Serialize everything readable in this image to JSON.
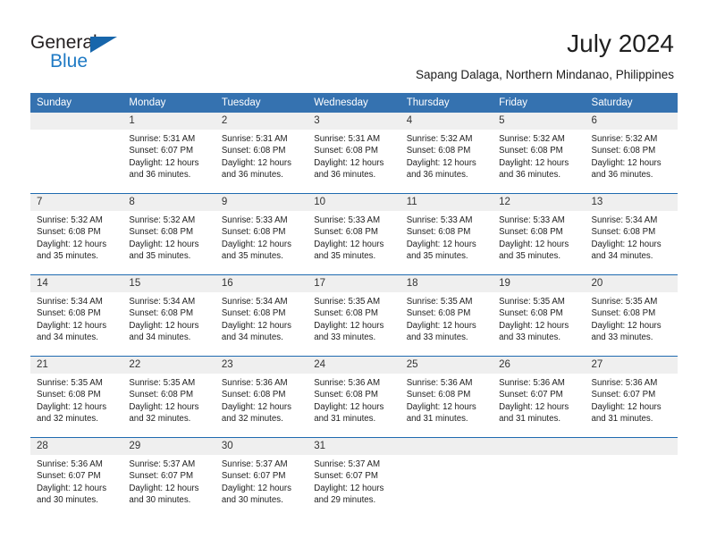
{
  "brand": {
    "word1": "General",
    "word2": "Blue",
    "triangle_color": "#1766ab",
    "blue_color": "#1f7ac4"
  },
  "header": {
    "month_title": "July 2024",
    "location": "Sapang Dalaga, Northern Mindanao, Philippines",
    "header_bg": "#3572b0",
    "daynum_bg": "#efefef",
    "week_separator_color": "#1f6bb0"
  },
  "calendar": {
    "weekday_headers": [
      "Sunday",
      "Monday",
      "Tuesday",
      "Wednesday",
      "Thursday",
      "Friday",
      "Saturday"
    ],
    "weeks": [
      [
        {
          "day": "",
          "lines": []
        },
        {
          "day": "1",
          "lines": [
            "Sunrise: 5:31 AM",
            "Sunset: 6:07 PM",
            "Daylight: 12 hours",
            "and 36 minutes."
          ]
        },
        {
          "day": "2",
          "lines": [
            "Sunrise: 5:31 AM",
            "Sunset: 6:08 PM",
            "Daylight: 12 hours",
            "and 36 minutes."
          ]
        },
        {
          "day": "3",
          "lines": [
            "Sunrise: 5:31 AM",
            "Sunset: 6:08 PM",
            "Daylight: 12 hours",
            "and 36 minutes."
          ]
        },
        {
          "day": "4",
          "lines": [
            "Sunrise: 5:32 AM",
            "Sunset: 6:08 PM",
            "Daylight: 12 hours",
            "and 36 minutes."
          ]
        },
        {
          "day": "5",
          "lines": [
            "Sunrise: 5:32 AM",
            "Sunset: 6:08 PM",
            "Daylight: 12 hours",
            "and 36 minutes."
          ]
        },
        {
          "day": "6",
          "lines": [
            "Sunrise: 5:32 AM",
            "Sunset: 6:08 PM",
            "Daylight: 12 hours",
            "and 36 minutes."
          ]
        }
      ],
      [
        {
          "day": "7",
          "lines": [
            "Sunrise: 5:32 AM",
            "Sunset: 6:08 PM",
            "Daylight: 12 hours",
            "and 35 minutes."
          ]
        },
        {
          "day": "8",
          "lines": [
            "Sunrise: 5:32 AM",
            "Sunset: 6:08 PM",
            "Daylight: 12 hours",
            "and 35 minutes."
          ]
        },
        {
          "day": "9",
          "lines": [
            "Sunrise: 5:33 AM",
            "Sunset: 6:08 PM",
            "Daylight: 12 hours",
            "and 35 minutes."
          ]
        },
        {
          "day": "10",
          "lines": [
            "Sunrise: 5:33 AM",
            "Sunset: 6:08 PM",
            "Daylight: 12 hours",
            "and 35 minutes."
          ]
        },
        {
          "day": "11",
          "lines": [
            "Sunrise: 5:33 AM",
            "Sunset: 6:08 PM",
            "Daylight: 12 hours",
            "and 35 minutes."
          ]
        },
        {
          "day": "12",
          "lines": [
            "Sunrise: 5:33 AM",
            "Sunset: 6:08 PM",
            "Daylight: 12 hours",
            "and 35 minutes."
          ]
        },
        {
          "day": "13",
          "lines": [
            "Sunrise: 5:34 AM",
            "Sunset: 6:08 PM",
            "Daylight: 12 hours",
            "and 34 minutes."
          ]
        }
      ],
      [
        {
          "day": "14",
          "lines": [
            "Sunrise: 5:34 AM",
            "Sunset: 6:08 PM",
            "Daylight: 12 hours",
            "and 34 minutes."
          ]
        },
        {
          "day": "15",
          "lines": [
            "Sunrise: 5:34 AM",
            "Sunset: 6:08 PM",
            "Daylight: 12 hours",
            "and 34 minutes."
          ]
        },
        {
          "day": "16",
          "lines": [
            "Sunrise: 5:34 AM",
            "Sunset: 6:08 PM",
            "Daylight: 12 hours",
            "and 34 minutes."
          ]
        },
        {
          "day": "17",
          "lines": [
            "Sunrise: 5:35 AM",
            "Sunset: 6:08 PM",
            "Daylight: 12 hours",
            "and 33 minutes."
          ]
        },
        {
          "day": "18",
          "lines": [
            "Sunrise: 5:35 AM",
            "Sunset: 6:08 PM",
            "Daylight: 12 hours",
            "and 33 minutes."
          ]
        },
        {
          "day": "19",
          "lines": [
            "Sunrise: 5:35 AM",
            "Sunset: 6:08 PM",
            "Daylight: 12 hours",
            "and 33 minutes."
          ]
        },
        {
          "day": "20",
          "lines": [
            "Sunrise: 5:35 AM",
            "Sunset: 6:08 PM",
            "Daylight: 12 hours",
            "and 33 minutes."
          ]
        }
      ],
      [
        {
          "day": "21",
          "lines": [
            "Sunrise: 5:35 AM",
            "Sunset: 6:08 PM",
            "Daylight: 12 hours",
            "and 32 minutes."
          ]
        },
        {
          "day": "22",
          "lines": [
            "Sunrise: 5:35 AM",
            "Sunset: 6:08 PM",
            "Daylight: 12 hours",
            "and 32 minutes."
          ]
        },
        {
          "day": "23",
          "lines": [
            "Sunrise: 5:36 AM",
            "Sunset: 6:08 PM",
            "Daylight: 12 hours",
            "and 32 minutes."
          ]
        },
        {
          "day": "24",
          "lines": [
            "Sunrise: 5:36 AM",
            "Sunset: 6:08 PM",
            "Daylight: 12 hours",
            "and 31 minutes."
          ]
        },
        {
          "day": "25",
          "lines": [
            "Sunrise: 5:36 AM",
            "Sunset: 6:08 PM",
            "Daylight: 12 hours",
            "and 31 minutes."
          ]
        },
        {
          "day": "26",
          "lines": [
            "Sunrise: 5:36 AM",
            "Sunset: 6:07 PM",
            "Daylight: 12 hours",
            "and 31 minutes."
          ]
        },
        {
          "day": "27",
          "lines": [
            "Sunrise: 5:36 AM",
            "Sunset: 6:07 PM",
            "Daylight: 12 hours",
            "and 31 minutes."
          ]
        }
      ],
      [
        {
          "day": "28",
          "lines": [
            "Sunrise: 5:36 AM",
            "Sunset: 6:07 PM",
            "Daylight: 12 hours",
            "and 30 minutes."
          ]
        },
        {
          "day": "29",
          "lines": [
            "Sunrise: 5:37 AM",
            "Sunset: 6:07 PM",
            "Daylight: 12 hours",
            "and 30 minutes."
          ]
        },
        {
          "day": "30",
          "lines": [
            "Sunrise: 5:37 AM",
            "Sunset: 6:07 PM",
            "Daylight: 12 hours",
            "and 30 minutes."
          ]
        },
        {
          "day": "31",
          "lines": [
            "Sunrise: 5:37 AM",
            "Sunset: 6:07 PM",
            "Daylight: 12 hours",
            "and 29 minutes."
          ]
        },
        {
          "day": "",
          "lines": []
        },
        {
          "day": "",
          "lines": []
        },
        {
          "day": "",
          "lines": []
        }
      ]
    ]
  }
}
